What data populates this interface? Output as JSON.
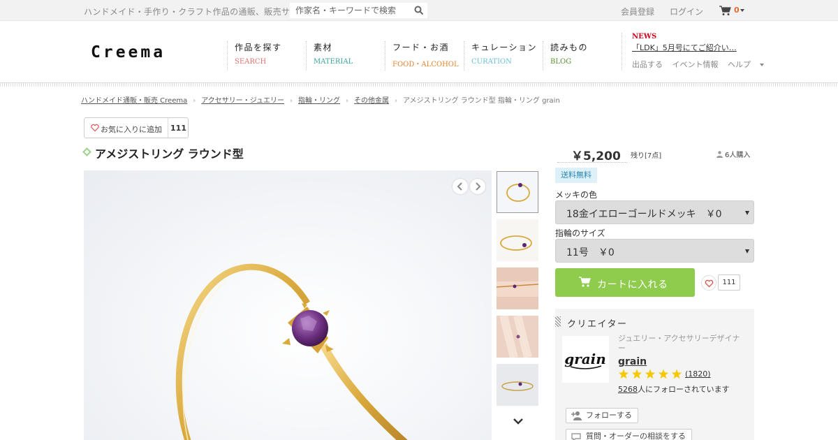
{
  "topbar": {
    "tagline": "ハンドメイド・手作り・クラフト作品の通販、販売サイト",
    "search_placeholder": "作家名・キーワードで検索",
    "register": "会員登録",
    "login": "ログイン",
    "cart_count": "0"
  },
  "header": {
    "logo": "Creema",
    "nav": [
      {
        "jp": "作品を探す",
        "en": "SEARCH",
        "color": "#e0716b"
      },
      {
        "jp": "素材",
        "en": "MATERIAL",
        "color": "#3aa59a"
      },
      {
        "jp": "フード・お酒",
        "en": "FOOD・ALCOHOL",
        "color": "#e8822a"
      },
      {
        "jp": "キュレーション",
        "en": "CURATION",
        "color": "#6cc0d8"
      },
      {
        "jp": "読みもの",
        "en": "BLOG",
        "color": "#5a8f2f"
      }
    ],
    "news_label": "NEWS",
    "news_text": "「LDK」5月号にてご紹介い…",
    "sub_links": [
      "出品する",
      "イベント情報",
      "ヘルプ"
    ]
  },
  "breadcrumb": {
    "items": [
      "ハンドメイド通販・販売 Creema",
      "アクセサリー・ジュエリー",
      "指輪・リング",
      "その他金属"
    ],
    "current": "アメジストリング ラウンド型 指輪・リング grain"
  },
  "favorite": {
    "label": "お気に入りに追加",
    "count": "111"
  },
  "product": {
    "title": "アメジストリング ラウンド型",
    "price": "￥5,200",
    "stock": "残り[7点]",
    "purchased": "6人購入",
    "free_shipping": "送料無料",
    "plating_label": "メッキの色",
    "plating_value": "18金イエローゴールドメッキ　￥0",
    "size_label": "指輪のサイズ",
    "size_value": "11号　￥0",
    "add_to_cart": "カートに入れる",
    "fav_count": "111"
  },
  "creator": {
    "heading": "クリエイター",
    "logo_text": "grain",
    "role": "ジュエリー・アクセサリーデザイナー",
    "name": "grain",
    "rating_stars": 5,
    "review_count": "(1820)",
    "followers_count": "5268",
    "followers_suffix": "人にフォローされています",
    "follow_btn": "フォローする",
    "consult_btn": "質問・オーダーの相談をする"
  },
  "colors": {
    "accent_green": "#8fcb4c",
    "star": "#f5c800",
    "badge_bg": "#dff1f8",
    "news_red": "#d0021b"
  }
}
